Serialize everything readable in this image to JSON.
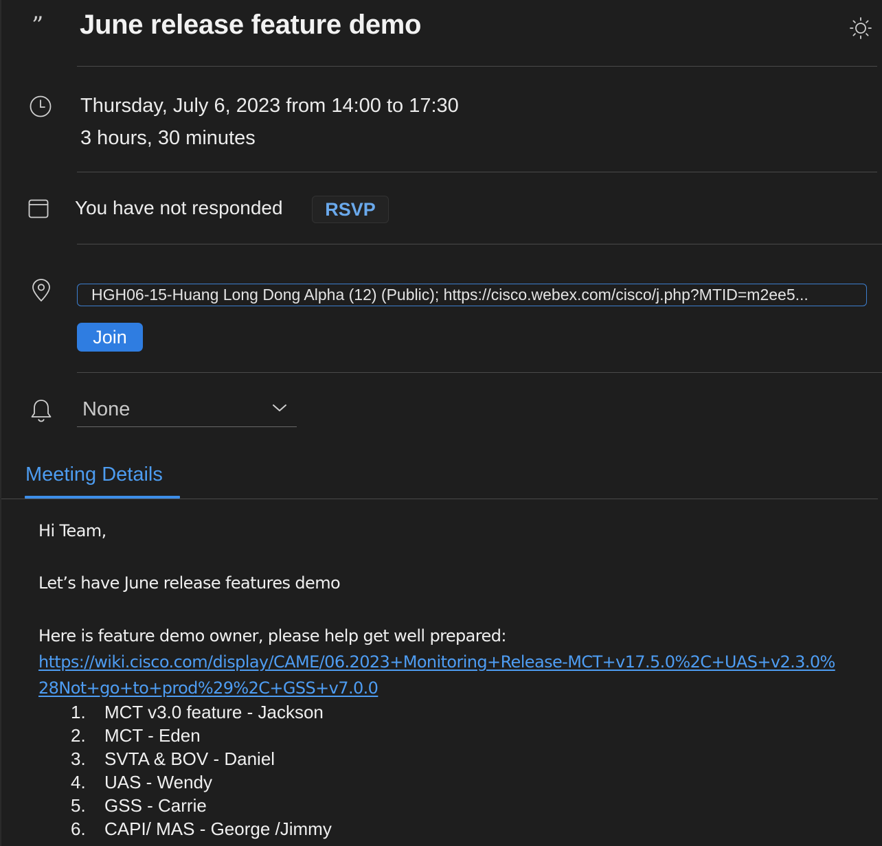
{
  "event": {
    "title": "June release feature demo",
    "datetime": "Thursday, July 6, 2023 from 14:00 to 17:30",
    "duration": "3 hours, 30 minutes"
  },
  "response": {
    "status_text": "You have not responded",
    "rsvp_label": "RSVP"
  },
  "location": {
    "value": "HGH06-15-Huang Long Dong Alpha (12) (Public); https://cisco.webex.com/cisco/j.php?MTID=m2ee5...",
    "join_label": "Join"
  },
  "reminder": {
    "selected": "None"
  },
  "tabs": [
    {
      "label": "Meeting Details",
      "active": true
    }
  ],
  "body": {
    "greeting": "Hi Team,",
    "intro": "Let’s have June release features demo",
    "owner_line": "Here is feature demo owner, please help get well prepared:",
    "link_line1": "https://wiki.cisco.com/display/CAME/06.2023+Monitoring+Release-MCT+v17.5.0%2C+UAS+v2.3.0%",
    "link_line2": "28Not+go+to+prod%29%2C+GSS+v7.0.0",
    "items": [
      {
        "num": "1.",
        "text": "MCT v3.0 feature - Jackson"
      },
      {
        "num": "2.",
        "text": "MCT - Eden"
      },
      {
        "num": "3.",
        "text": "SVTA & BOV - Daniel"
      },
      {
        "num": "4.",
        "text": "UAS - Wendy"
      },
      {
        "num": "5.",
        "text": "GSS - Carrie"
      },
      {
        "num": "6.",
        "text": "CAPI/ MAS - George /Jimmy"
      }
    ]
  },
  "icons": {
    "title": "quote-icon",
    "theme": "sun-icon",
    "time": "clock-icon",
    "response": "calendar-icon",
    "location": "location-pin-icon",
    "reminder": "bell-icon",
    "dropdown": "chevron-down-icon"
  },
  "colors": {
    "background": "#1e1e1e",
    "accent": "#2f7de1",
    "link": "#4e9df3",
    "text": "#ececec"
  }
}
